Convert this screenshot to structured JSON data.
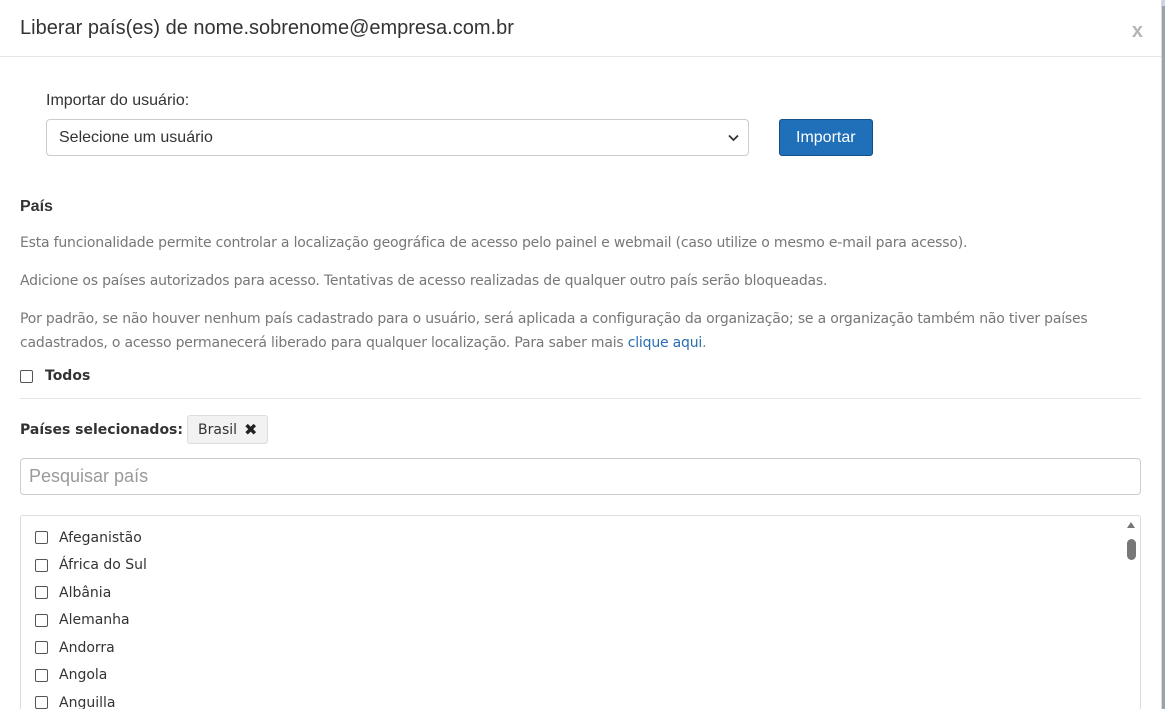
{
  "modal": {
    "title": "Liberar país(es) de nome.sobrenome@empresa.com.br",
    "close_label": "x"
  },
  "import": {
    "label": "Importar do usuário:",
    "select_value": "Selecione um usuário",
    "button_label": "Importar"
  },
  "country_section": {
    "title": "País",
    "desc1": "Esta funcionalidade permite controlar a localização geográfica de acesso pelo painel e webmail (caso utilize o mesmo e-mail para acesso).",
    "desc2": "Adicione os países autorizados para acesso. Tentativas de acesso realizadas de qualquer outro país serão bloqueadas.",
    "desc3": "Por padrão, se não houver nenhum país cadastrado para o usuário, será aplicada a configuração da organização; se a organização também não tiver países cadastrados, o acesso permanecerá liberado para qualquer localização. Para saber mais ",
    "link_text": "clique aqui",
    "desc3_end": ".",
    "todos_label": "Todos"
  },
  "selected": {
    "label": "Países selecionados:",
    "chips": [
      "Brasil"
    ],
    "remove_glyph": "✖"
  },
  "search": {
    "placeholder": "Pesquisar país"
  },
  "countries": [
    "Afeganistão",
    "África do Sul",
    "Albânia",
    "Alemanha",
    "Andorra",
    "Angola",
    "Anguilla"
  ]
}
